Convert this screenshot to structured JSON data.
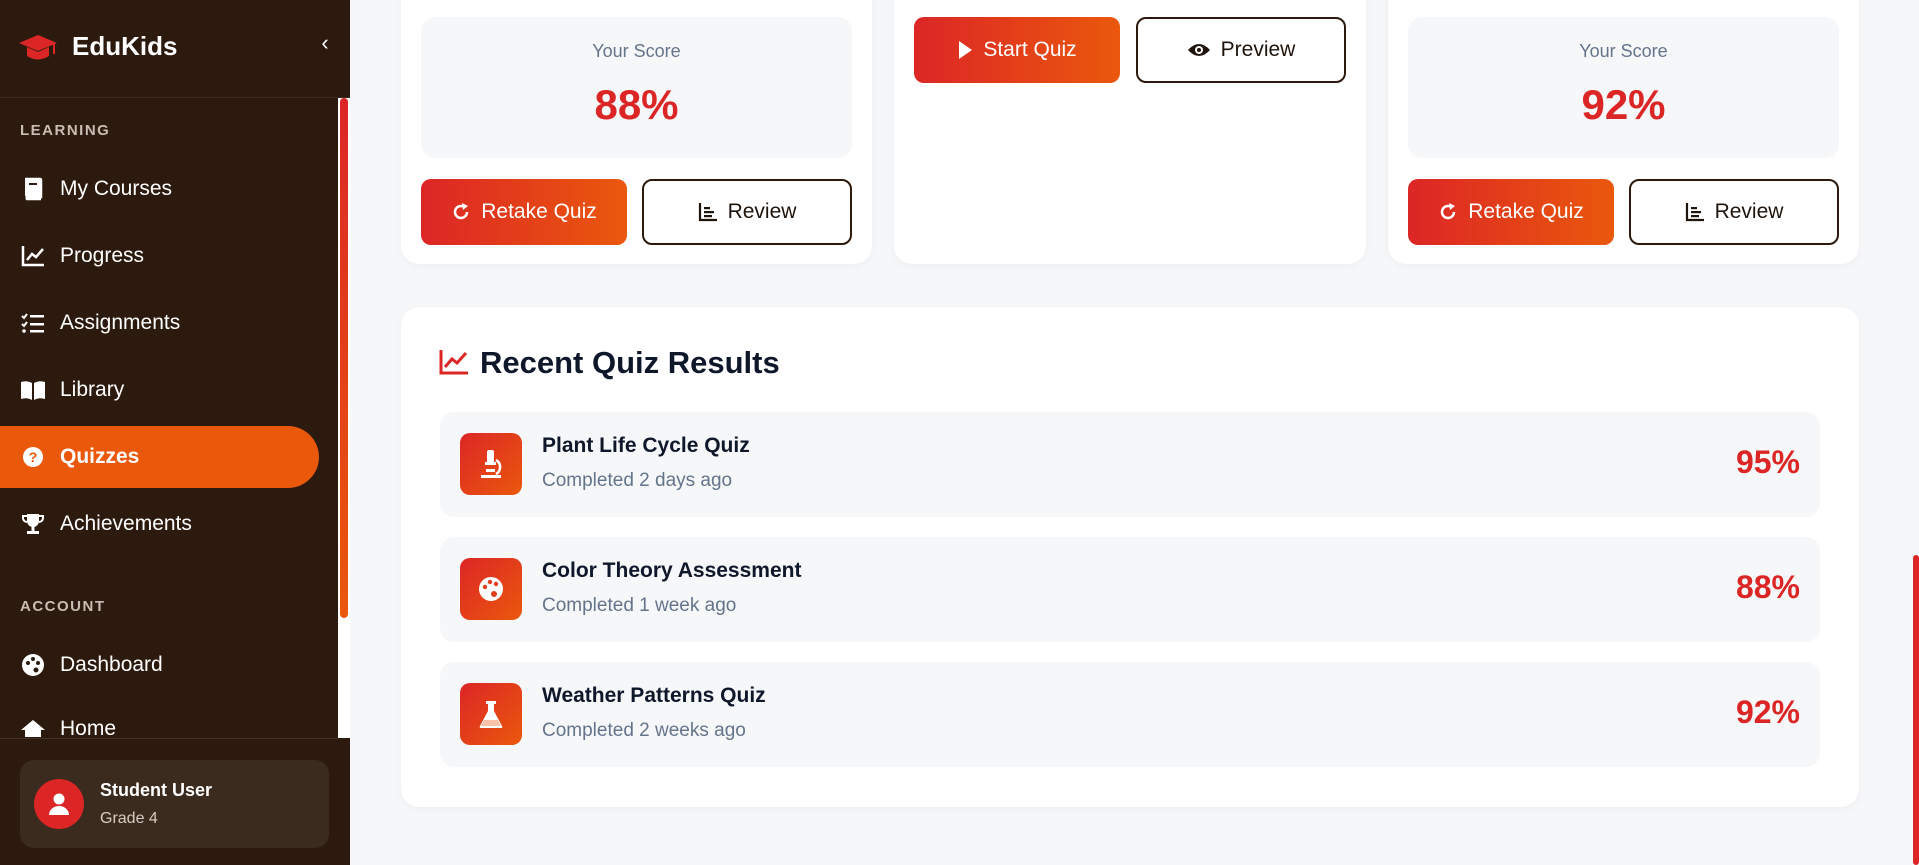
{
  "brand": {
    "name": "EduKids"
  },
  "sidebar": {
    "learning_label": "LEARNING",
    "account_label": "ACCOUNT",
    "items": [
      {
        "label": "My Courses",
        "icon": "book-icon"
      },
      {
        "label": "Progress",
        "icon": "chart-line-icon"
      },
      {
        "label": "Assignments",
        "icon": "list-check-icon"
      },
      {
        "label": "Library",
        "icon": "open-book-icon"
      },
      {
        "label": "Quizzes",
        "icon": "question-circle-icon",
        "active": true
      },
      {
        "label": "Achievements",
        "icon": "trophy-icon"
      }
    ],
    "account_items": [
      {
        "label": "Dashboard",
        "icon": "palette-icon"
      },
      {
        "label": "Home",
        "icon": "home-icon"
      }
    ]
  },
  "user": {
    "name": "Student User",
    "grade": "Grade 4"
  },
  "quiz_cards": [
    {
      "score_label": "Your Score",
      "score": "88%",
      "primary": "Retake Quiz",
      "secondary": "Review"
    },
    {
      "primary": "Start Quiz",
      "secondary": "Preview"
    },
    {
      "score_label": "Your Score",
      "score": "92%",
      "primary": "Retake Quiz",
      "secondary": "Review"
    }
  ],
  "recent": {
    "title": "Recent Quiz Results",
    "items": [
      {
        "name": "Plant Life Cycle Quiz",
        "time": "Completed 2 days ago",
        "score": "95%",
        "icon": "microscope-icon"
      },
      {
        "name": "Color Theory Assessment",
        "time": "Completed 1 week ago",
        "score": "88%",
        "icon": "palette-icon"
      },
      {
        "name": "Weather Patterns Quiz",
        "time": "Completed 2 weeks ago",
        "score": "92%",
        "icon": "flask-icon"
      }
    ]
  },
  "colors": {
    "primary": "#dc2626",
    "accent": "#ea580c",
    "sidebar": "#2c1a0e"
  }
}
